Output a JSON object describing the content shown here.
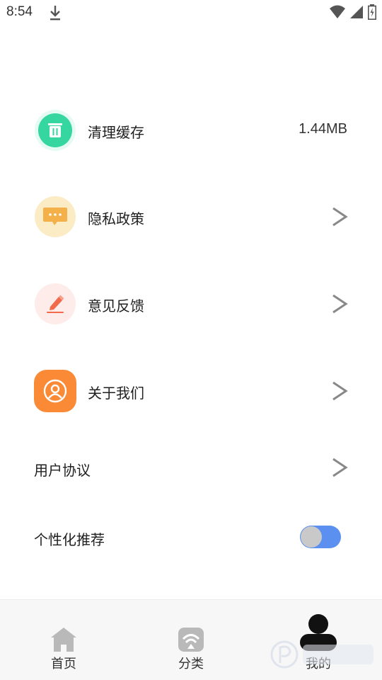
{
  "status_bar": {
    "time": "8:54",
    "icons": [
      "download-icon",
      "wifi-icon",
      "signal-icon",
      "battery-icon"
    ]
  },
  "settings": {
    "clear_cache": {
      "label": "清理缓存",
      "value": "1.44MB",
      "icon": "trash-icon",
      "icon_color": "#36d6a0"
    },
    "privacy_policy": {
      "label": "隐私政策",
      "icon": "chat-icon",
      "icon_color": "#f4b14a"
    },
    "feedback": {
      "label": "意见反馈",
      "icon": "pen-icon",
      "icon_color": "#f26a4b"
    },
    "about_us": {
      "label": "关于我们",
      "icon": "user-circle-icon",
      "icon_color": "#fa8a36"
    },
    "user_agreement": {
      "label": "用户协议"
    },
    "personalized": {
      "label": "个性化推荐",
      "toggle_color": "#5b8ff0"
    }
  },
  "bottom_nav": {
    "home": {
      "label": "首页",
      "icon": "home-icon"
    },
    "category": {
      "label": "分类",
      "icon": "category-icon"
    },
    "mine": {
      "label": "我的",
      "icon": "person-icon"
    }
  }
}
